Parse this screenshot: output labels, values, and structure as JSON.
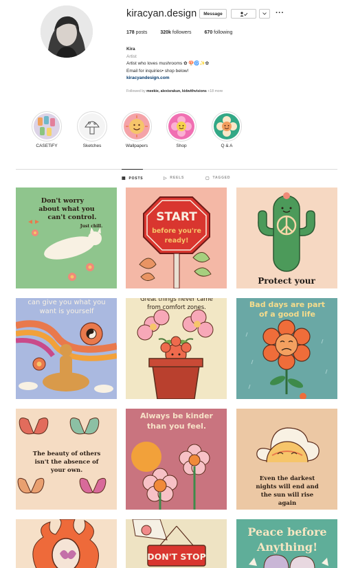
{
  "profile": {
    "username": "kiracyan.design",
    "message_label": "Message",
    "follow_label": "✓",
    "dropdown_label": "⌄",
    "more_label": "···",
    "posts_count": "178",
    "posts_label": "posts",
    "followers_count": "320k",
    "followers_label": "followers",
    "following_count": "670",
    "following_label": "following",
    "name": "Kira",
    "category": "Artist",
    "bio_line1": "Artist who loves mushrooms ✿ 🍄🌀✨✿",
    "bio_line2": "Email for inquiries• shop below!",
    "website": "kiracyandesign.com",
    "followed_by_prefix": "Followed by",
    "followed_by_names": "meekie, alexisrakun, kidwithvisions",
    "followed_by_more": "+18 more"
  },
  "highlights": [
    {
      "label": "CASETiFY"
    },
    {
      "label": "Sketches"
    },
    {
      "label": "Wallpapers"
    },
    {
      "label": "Shop"
    },
    {
      "label": "Q & A"
    }
  ],
  "tabs": {
    "posts": "POSTS",
    "reels": "REELS",
    "tagged": "TAGGED"
  },
  "posts": [
    {
      "text": "Don't worry about what you can't control.",
      "sub": "Just chill.",
      "bg": "#8fc58d"
    },
    {
      "text": "START before you're ready!",
      "bg": "#f4b8a6"
    },
    {
      "text": "Protect your",
      "bg": "#f6d8c2"
    },
    {
      "text": "can give you what you want is yourself",
      "bg": "#aab9e0"
    },
    {
      "text": "Great things never came from comfort zones.",
      "bg": "#f2e7c5"
    },
    {
      "text": "Bad days are part of a good life",
      "bg": "#6aa8a5"
    },
    {
      "text": "The beauty of others isn't the absence of your own.",
      "bg": "#f5dcc3"
    },
    {
      "text": "Always be kinder than you feel.",
      "bg": "#c9747f"
    },
    {
      "text": "Even the darkest nights will end and the sun will rise again",
      "bg": "#ecc8a4"
    },
    {
      "text": "",
      "bg": "#f6e0c8"
    },
    {
      "text": "DON'T STOP",
      "bg": "#eee3c3"
    },
    {
      "text": "Peace before Anything!",
      "bg": "#5fae99"
    }
  ],
  "colors": {
    "text": "#262626",
    "muted": "#8e8e8e",
    "link": "#00376b",
    "border": "#dbdbdb"
  }
}
